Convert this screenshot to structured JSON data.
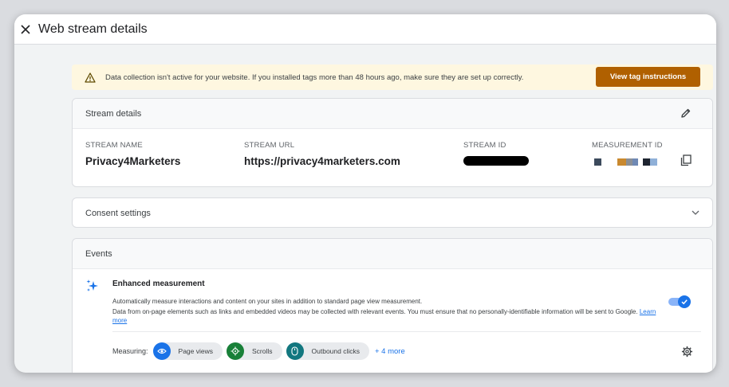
{
  "header": {
    "title": "Web stream details",
    "close_icon": "close-icon"
  },
  "banner": {
    "icon": "warning-icon",
    "text": "Data collection isn't active for your website. If you installed tags more than 48 hours ago, make sure they are set up correctly.",
    "button_label": "View tag instructions",
    "button_color": "#b06000",
    "background": "#fef7e0"
  },
  "stream_details": {
    "title": "Stream details",
    "edit_icon": "edit-icon",
    "fields": {
      "name": {
        "label": "STREAM NAME",
        "value": "Privacy4Marketers"
      },
      "url": {
        "label": "STREAM URL",
        "value": "https://privacy4marketers.com"
      },
      "id": {
        "label": "STREAM ID"
      },
      "measurement_id": {
        "label": "MEASUREMENT ID"
      }
    },
    "copy_icon": "copy-icon"
  },
  "consent": {
    "title": "Consent settings",
    "expand_icon": "chevron-down-icon"
  },
  "events": {
    "title": "Events",
    "enhanced": {
      "title": "Enhanced measurement",
      "desc1": "Automatically measure interactions and content on your sites in addition to standard page view measurement.",
      "desc2": "Data from on-page elements such as links and embedded videos may be collected with relevant events. You must ensure that no personally-identifiable information will be sent to Google.",
      "learn_more": "Learn more",
      "toggle_on": true
    },
    "measuring_label": "Measuring:",
    "chips": [
      {
        "label": "Page views",
        "icon": "eye-icon",
        "color": "#1a73e8"
      },
      {
        "label": "Scrolls",
        "icon": "scroll-target-icon",
        "color": "#188038"
      },
      {
        "label": "Outbound clicks",
        "icon": "mouse-icon",
        "color": "#12777f"
      }
    ],
    "more_link": "+ 4 more",
    "settings_icon": "gear-icon"
  }
}
